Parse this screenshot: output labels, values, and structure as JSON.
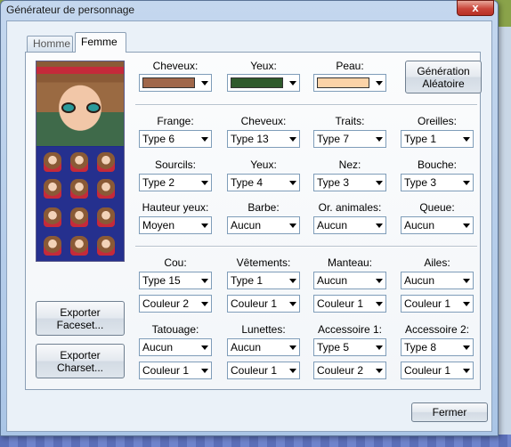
{
  "window": {
    "title": "Générateur de personnage",
    "close_label": "x"
  },
  "tabs": [
    {
      "label": "Homme",
      "active": false
    },
    {
      "label": "Femme",
      "active": true
    }
  ],
  "colors_row": [
    {
      "label": "Cheveux:",
      "swatch": "#a0674a"
    },
    {
      "label": "Yeux:",
      "swatch": "#2f5a2c"
    },
    {
      "label": "Peau:",
      "swatch": "#fbd3a8"
    }
  ],
  "random_button": {
    "line1": "Génération",
    "line2": "Aléatoire"
  },
  "parts_rows": [
    [
      {
        "label": "Frange:",
        "value": "Type 6"
      },
      {
        "label": "Cheveux:",
        "value": "Type 13"
      },
      {
        "label": "Traits:",
        "value": "Type 7"
      },
      {
        "label": "Oreilles:",
        "value": "Type 1"
      }
    ],
    [
      {
        "label": "Sourcils:",
        "value": "Type 2"
      },
      {
        "label": "Yeux:",
        "value": "Type 4"
      },
      {
        "label": "Nez:",
        "value": "Type 3"
      },
      {
        "label": "Bouche:",
        "value": "Type 3"
      }
    ],
    [
      {
        "label": "Hauteur yeux:",
        "value": "Moyen"
      },
      {
        "label": "Barbe:",
        "value": "Aucun"
      },
      {
        "label": "Or. animales:",
        "value": "Aucun"
      },
      {
        "label": "Queue:",
        "value": "Aucun"
      }
    ]
  ],
  "accessory_rows": [
    [
      {
        "label": "Cou:",
        "value": "Type 15",
        "color": "Couleur 2"
      },
      {
        "label": "Vêtements:",
        "value": "Type 1",
        "color": "Couleur 1"
      },
      {
        "label": "Manteau:",
        "value": "Aucun",
        "color": "Couleur 1"
      },
      {
        "label": "Ailes:",
        "value": "Aucun",
        "color": "Couleur 1"
      }
    ],
    [
      {
        "label": "Tatouage:",
        "value": "Aucun",
        "color": "Couleur 1"
      },
      {
        "label": "Lunettes:",
        "value": "Aucun",
        "color": "Couleur 1"
      },
      {
        "label": "Accessoire 1:",
        "value": "Type 5",
        "color": "Couleur 2"
      },
      {
        "label": "Accessoire 2:",
        "value": "Type 8",
        "color": "Couleur 1"
      }
    ]
  ],
  "export_faceset": {
    "line1": "Exporter",
    "line2": "Faceset..."
  },
  "export_charset": {
    "line1": "Exporter",
    "line2": "Charset..."
  },
  "close_button": "Fermer"
}
